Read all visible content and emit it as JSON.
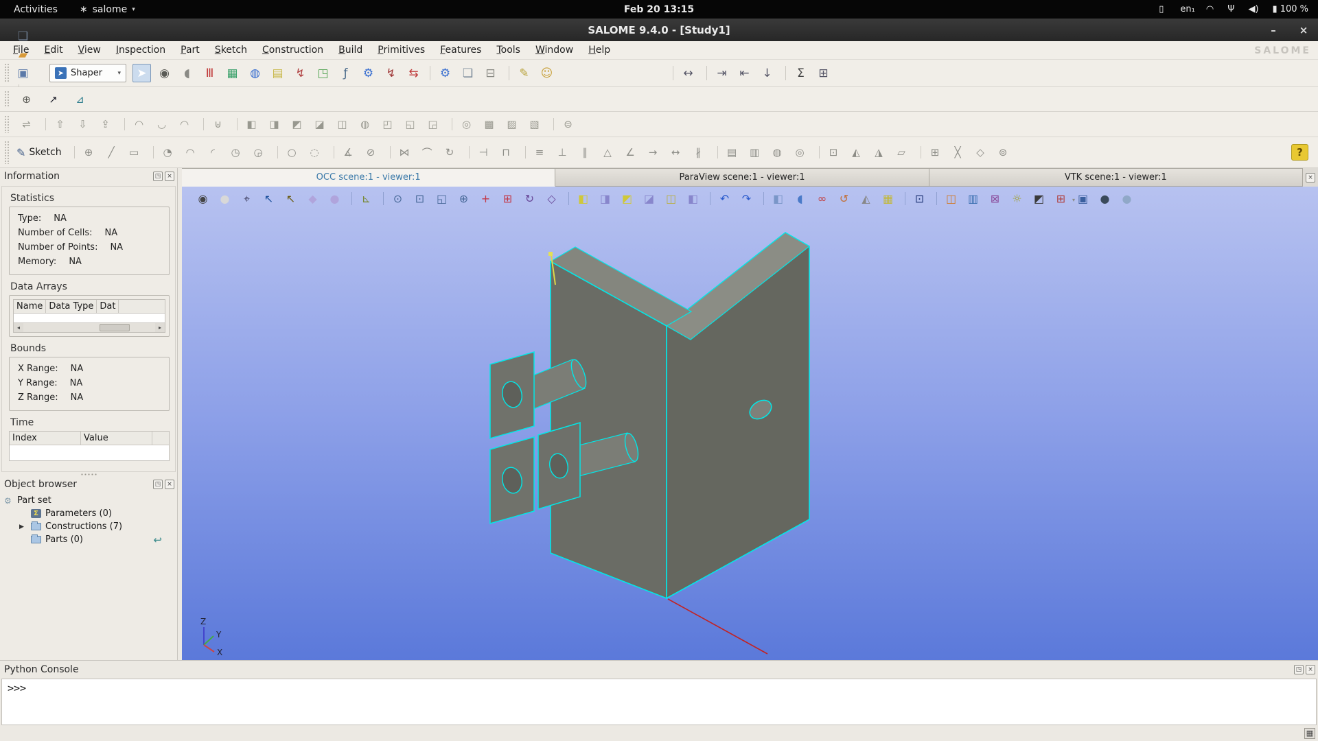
{
  "gnome_bar": {
    "activities": "Activities",
    "app": {
      "icon_glyph": "∗",
      "label": "salome"
    },
    "clock": "Feb 20 13:15",
    "tray": [
      {
        "name": "indicator-icon",
        "glyph": "▯",
        "caret": true
      },
      {
        "name": "keyboard-layout-indicator",
        "label": "en₁",
        "caret": true
      },
      {
        "name": "wifi-icon",
        "glyph": "◠"
      },
      {
        "name": "microphone-icon",
        "glyph": "Ψ"
      },
      {
        "name": "volume-icon",
        "glyph": "◀)"
      },
      {
        "name": "battery-indicator",
        "glyph": "▮",
        "label": "100 %",
        "caret": true
      }
    ]
  },
  "window": {
    "title": "SALOME 9.4.0 - [Study1]",
    "minimize": "–",
    "close": "×"
  },
  "menubar": {
    "items": [
      "File",
      "Edit",
      "View",
      "Inspection",
      "Part",
      "Sketch",
      "Construction",
      "Build",
      "Primitives",
      "Features",
      "Tools",
      "Window",
      "Help"
    ],
    "logo": "SALOME"
  },
  "toolbar_main": {
    "file_icons": [
      {
        "name": "new-document-icon",
        "glyph": "❏",
        "color": "#6f7f93"
      },
      {
        "name": "open-folder-icon",
        "glyph": "▰",
        "color": "#d89a3a"
      },
      {
        "name": "save-icon",
        "glyph": "▣",
        "color": "#5b79a8"
      },
      {
        "name": "undo-icon",
        "glyph": "↶",
        "color": "#8a8a84",
        "caret": true,
        "sep": true
      },
      {
        "name": "redo-icon",
        "glyph": "↷",
        "color": "#8a8a84",
        "caret": true,
        "sep": true
      }
    ],
    "module_combo": {
      "icon": "➤",
      "label": "Shaper"
    },
    "modules": [
      {
        "name": "shaper-module-button",
        "glyph": "➤",
        "color": "#ffffff",
        "press": "blue"
      },
      {
        "name": "search-module-icon",
        "glyph": "◉",
        "color": "#5a5a55"
      },
      {
        "name": "sculpt-module-icon",
        "glyph": "◖",
        "color": "#8a8a85"
      },
      {
        "name": "paravis-module-icon",
        "glyph": "Ⅲ",
        "color": "#c03a3a"
      },
      {
        "name": "mesh-module-icon",
        "glyph": "▦",
        "color": "#3aa06a"
      },
      {
        "name": "geom-module-icon",
        "glyph": "◍",
        "color": "#3a6fd0"
      },
      {
        "name": "notes-module-icon",
        "glyph": "▤",
        "color": "#c8b84a"
      },
      {
        "name": "weld-module-icon",
        "glyph": "↯",
        "color": "#b04040"
      },
      {
        "name": "shape-module-icon",
        "glyph": "◳",
        "color": "#4aa04a"
      },
      {
        "name": "fca-module-icon",
        "glyph": "ƒ",
        "color": "#4a6a8a"
      },
      {
        "name": "gear-module-icon",
        "glyph": "⚙",
        "color": "#3a6fd0"
      },
      {
        "name": "tool-module-icon",
        "glyph": "↯",
        "color": "#a03a3a"
      },
      {
        "name": "split-module-icon",
        "glyph": "⇆",
        "color": "#c03a3a"
      }
    ],
    "actions": [
      {
        "name": "settings-icon",
        "glyph": "⚙",
        "color": "#3a6fd0",
        "sep": true
      },
      {
        "name": "copy-icon",
        "glyph": "❏",
        "color": "#7a8a9a"
      },
      {
        "name": "delete-icon",
        "glyph": "⊟",
        "color": "#8a8a84"
      },
      {
        "name": "script-icon",
        "glyph": "✎",
        "color": "#b8a23a",
        "sep": true
      },
      {
        "name": "user-icon",
        "glyph": "☺",
        "color": "#c8a03a"
      }
    ],
    "study_tools": [
      {
        "name": "fit-width-icon",
        "glyph": "↔",
        "color": "#555566",
        "sep": true
      },
      {
        "name": "export-icon",
        "glyph": "⇥",
        "color": "#555566",
        "sep": true
      },
      {
        "name": "import-icon",
        "glyph": "⇤",
        "color": "#555566"
      },
      {
        "name": "download-icon",
        "glyph": "↓",
        "color": "#555566"
      },
      {
        "name": "sum-icon",
        "glyph": "Σ",
        "color": "#444444",
        "sep": true
      },
      {
        "name": "table-icon",
        "glyph": "⊞",
        "color": "#555566"
      }
    ]
  },
  "toolbar_datum": [
    {
      "name": "datum-point-icon",
      "glyph": "⊕",
      "color": "#555550"
    },
    {
      "name": "datum-axis-icon",
      "glyph": "↗",
      "color": "#22232e"
    },
    {
      "name": "datum-plane-icon",
      "glyph": "⊿",
      "color": "#2a7b8c"
    }
  ],
  "toolbar_features": [
    {
      "name": "feature-part-icon",
      "glyph": "⇌",
      "color": "#98988f"
    },
    {
      "name": "feature-export-icon",
      "glyph": "⇧",
      "color": "#98988f",
      "sep": true
    },
    {
      "name": "feature-import-icon",
      "glyph": "⇩",
      "color": "#98988f"
    },
    {
      "name": "feature-load-icon",
      "glyph": "⇪",
      "color": "#98988f"
    },
    {
      "name": "feature-extrusion-icon",
      "glyph": "◠",
      "color": "#98988f",
      "sep": true
    },
    {
      "name": "feature-extrusion-cut-icon",
      "glyph": "◡",
      "color": "#98988f"
    },
    {
      "name": "feature-extrusion-fuse-icon",
      "glyph": "◠",
      "color": "#98988f"
    },
    {
      "name": "feature-revolution-icon",
      "glyph": "⊎",
      "color": "#98988f",
      "sep": true
    },
    {
      "name": "boolean-cut-icon",
      "glyph": "◧",
      "color": "#98988f",
      "sep": true
    },
    {
      "name": "boolean-fuse-icon",
      "glyph": "◨",
      "color": "#98988f"
    },
    {
      "name": "boolean-common-icon",
      "glyph": "◩",
      "color": "#98988f"
    },
    {
      "name": "boolean-smash-icon",
      "glyph": "◪",
      "color": "#98988f"
    },
    {
      "name": "boolean-fill-icon",
      "glyph": "◫",
      "color": "#98988f"
    },
    {
      "name": "feature-union-icon",
      "glyph": "◍",
      "color": "#98988f"
    },
    {
      "name": "feature-partition-icon",
      "glyph": "◰",
      "color": "#98988f"
    },
    {
      "name": "feature-pipe-icon",
      "glyph": "◱",
      "color": "#98988f"
    },
    {
      "name": "feature-loft-icon",
      "glyph": "◲",
      "color": "#98988f"
    },
    {
      "name": "feature-fillet-icon",
      "glyph": "◎",
      "color": "#98988f",
      "sep": true
    },
    {
      "name": "feature-chamfer-icon",
      "glyph": "▩",
      "color": "#98988f"
    },
    {
      "name": "feature-scale-icon",
      "glyph": "▨",
      "color": "#98988f"
    },
    {
      "name": "feature-measure-icon",
      "glyph": "▧",
      "color": "#98988f"
    },
    {
      "name": "feature-group-icon",
      "glyph": "⊜",
      "color": "#98988f",
      "sep": true
    }
  ],
  "sketch_toolbar": {
    "button_label": "Sketch",
    "tools": [
      {
        "name": "sketch-point-icon",
        "glyph": "⊕",
        "color": "#8d8d87",
        "sep": true
      },
      {
        "name": "sketch-line-icon",
        "glyph": "╱",
        "color": "#8d8d87"
      },
      {
        "name": "sketch-rectangle-icon",
        "glyph": "▭",
        "color": "#8d8d87"
      },
      {
        "name": "sketch-circle-arc-icon",
        "glyph": "◔",
        "color": "#8d8d87",
        "sep": true
      },
      {
        "name": "sketch-arc-icon",
        "glyph": "◠",
        "color": "#8d8d87"
      },
      {
        "name": "sketch-arc-tangent-icon",
        "glyph": "◜",
        "color": "#8d8d87"
      },
      {
        "name": "sketch-arc-center-icon",
        "glyph": "◷",
        "color": "#8d8d87"
      },
      {
        "name": "sketch-arc-three-point-icon",
        "glyph": "◶",
        "color": "#8d8d87"
      },
      {
        "name": "sketch-circle-icon",
        "glyph": "○",
        "color": "#8d8d87",
        "sep": true
      },
      {
        "name": "sketch-ellipse-icon",
        "glyph": "◌",
        "color": "#8d8d87"
      },
      {
        "name": "sketch-fillet-icon",
        "glyph": "∡",
        "color": "#8d8d87",
        "sep": true
      },
      {
        "name": "sketch-trim-icon",
        "glyph": "⊘",
        "color": "#8d8d87"
      },
      {
        "name": "sketch-mirror-icon",
        "glyph": "⋈",
        "color": "#8d8d87",
        "sep": true
      },
      {
        "name": "sketch-offset-icon",
        "glyph": "⌒",
        "color": "#8d8d87"
      },
      {
        "name": "sketch-rotate-icon",
        "glyph": "↻",
        "color": "#8d8d87"
      },
      {
        "name": "constraint-distance-icon",
        "glyph": "⊣",
        "color": "#8d8d87",
        "sep": true
      },
      {
        "name": "constraint-length-icon",
        "glyph": "⊓",
        "color": "#8d8d87"
      },
      {
        "name": "constraint-equal-icon",
        "glyph": "≡",
        "color": "#8d8d87",
        "sep": true
      },
      {
        "name": "constraint-perpendicular-icon",
        "glyph": "⊥",
        "color": "#8d8d87"
      },
      {
        "name": "constraint-parallel-icon",
        "glyph": "∥",
        "color": "#8d8d87"
      },
      {
        "name": "constraint-horizontal-icon",
        "glyph": "△",
        "color": "#8d8d87"
      },
      {
        "name": "constraint-angle-icon",
        "glyph": "∠",
        "color": "#8d8d87"
      },
      {
        "name": "constraint-tangent-icon",
        "glyph": "→",
        "color": "#8d8d87"
      },
      {
        "name": "constraint-middle-icon",
        "glyph": "↔",
        "color": "#8d8d87"
      },
      {
        "name": "constraint-collinear-icon",
        "glyph": "∦",
        "color": "#8d8d87"
      },
      {
        "name": "sketch-projection-icon",
        "glyph": "▤",
        "color": "#8d8d87",
        "sep": true
      },
      {
        "name": "sketch-intersection-icon",
        "glyph": "▥",
        "color": "#8d8d87"
      },
      {
        "name": "sketch-split-icon",
        "glyph": "◍",
        "color": "#8d8d87"
      },
      {
        "name": "sketch-substitution-icon",
        "glyph": "◎",
        "color": "#8d8d87"
      },
      {
        "name": "sketch-copy-icon",
        "glyph": "⊡",
        "color": "#8d8d87",
        "sep": true
      },
      {
        "name": "sketch-multi-rotate-icon",
        "glyph": "◭",
        "color": "#8d8d87"
      },
      {
        "name": "sketch-multi-translate-icon",
        "glyph": "◮",
        "color": "#8d8d87"
      },
      {
        "name": "sketch-pattern-icon",
        "glyph": "▱",
        "color": "#8d8d87"
      },
      {
        "name": "sketch-options-icon",
        "glyph": "⊞",
        "color": "#8d8d87",
        "sep": true
      },
      {
        "name": "sketch-cross-icon",
        "glyph": "╳",
        "color": "#8d8d87"
      },
      {
        "name": "sketch-rhombus-icon",
        "glyph": "◇",
        "color": "#8d8d87"
      },
      {
        "name": "sketch-target-icon",
        "glyph": "⊚",
        "color": "#8d8d87"
      }
    ],
    "help_glyph": "?"
  },
  "tabs": [
    {
      "name": "tab-occ-viewer",
      "label": "OCC scene:1 - viewer:1",
      "active": true
    },
    {
      "name": "tab-paraview-viewer",
      "label": "ParaView scene:1 - viewer:1",
      "active": false
    },
    {
      "name": "tab-vtk-viewer",
      "label": "VTK scene:1 - viewer:1",
      "active": false
    }
  ],
  "tab_close_glyph": "×",
  "info_panel": {
    "title": "Information",
    "float_glyph": "◳",
    "close_glyph": "×",
    "statistics": {
      "label": "Statistics",
      "rows": [
        {
          "label": "Type:",
          "value": "NA"
        },
        {
          "label": "Number of Cells:",
          "value": "NA"
        },
        {
          "label": "Number of Points:",
          "value": "NA"
        },
        {
          "label": "Memory:",
          "value": "NA"
        }
      ]
    },
    "data_arrays": {
      "label": "Data Arrays",
      "headers": [
        "Name",
        "Data Type",
        "Dat"
      ]
    },
    "bounds": {
      "label": "Bounds",
      "rows": [
        {
          "label": "X Range:",
          "value": "NA"
        },
        {
          "label": "Y Range:",
          "value": "NA"
        },
        {
          "label": "Z Range:",
          "value": "NA"
        }
      ]
    },
    "time": {
      "label": "Time",
      "headers": [
        "Index",
        "Value"
      ]
    }
  },
  "object_browser": {
    "title": "Object browser",
    "float_glyph": "◳",
    "close_glyph": "×",
    "root": {
      "label": "Part set",
      "icon_glyph": "⚙",
      "icon_color": "#7f9aaa"
    },
    "items": [
      {
        "name": "tree-item-parameters",
        "label": "Parameters (0)",
        "icon": "sigma"
      },
      {
        "name": "tree-item-constructions",
        "label": "Constructions (7)",
        "icon": "folder",
        "expandable": true
      },
      {
        "name": "tree-item-parts",
        "label": "Parts (0)",
        "icon": "folder",
        "action_glyph": "↩"
      }
    ]
  },
  "viewport": {
    "toolbar": [
      {
        "name": "dump-view-icon",
        "glyph": "◉",
        "color": "#444444"
      },
      {
        "name": "mouse-style-icon",
        "glyph": "●",
        "color": "#d8d8d8"
      },
      {
        "name": "interaction-style-icon",
        "glyph": "⌖",
        "color": "#444466"
      },
      {
        "name": "select-arrow-icon",
        "glyph": "↖",
        "color": "#1a4f9c",
        "press": "blue"
      },
      {
        "name": "select-rect-icon",
        "glyph": "↖",
        "color": "#6a5a10",
        "press": "yellow"
      },
      {
        "name": "polygon-selection-icon",
        "glyph": "◆",
        "color": "#b0a4dc"
      },
      {
        "name": "circle-selection-icon",
        "glyph": "●",
        "color": "#b0a4dc"
      },
      {
        "name": "trihedron-icon",
        "glyph": "⊾",
        "color": "#7a8a3a",
        "sep": true
      },
      {
        "name": "zoom-icon",
        "glyph": "⊙",
        "color": "#4a6a9a",
        "sep": true
      },
      {
        "name": "zoom-window-icon",
        "glyph": "⊡",
        "color": "#4a6a9a"
      },
      {
        "name": "zoom-region-icon",
        "glyph": "◱",
        "color": "#4a6a9a"
      },
      {
        "name": "zoom-plus-icon",
        "glyph": "⊕",
        "color": "#4a6a9a"
      },
      {
        "name": "pan-icon",
        "glyph": "+",
        "color": "#c23a4a"
      },
      {
        "name": "global-pan-icon",
        "glyph": "⊞",
        "color": "#c23a4a"
      },
      {
        "name": "rotate-icon",
        "glyph": "↻",
        "color": "#6a4a9a"
      },
      {
        "name": "rotation-point-icon",
        "glyph": "◇",
        "color": "#6a4a9a"
      },
      {
        "name": "front-view-icon",
        "glyph": "◧",
        "color": "#cfc83a",
        "sep": true
      },
      {
        "name": "back-view-icon",
        "glyph": "◨",
        "color": "#8886cc"
      },
      {
        "name": "top-view-icon",
        "glyph": "◩",
        "color": "#cfc83a"
      },
      {
        "name": "bottom-view-icon",
        "glyph": "◪",
        "color": "#8886cc"
      },
      {
        "name": "left-view-icon",
        "glyph": "◫",
        "color": "#b8b048"
      },
      {
        "name": "right-view-icon",
        "glyph": "◧",
        "color": "#8886cc"
      },
      {
        "name": "undo-view-icon",
        "glyph": "↶",
        "color": "#2a5acc",
        "sep": true
      },
      {
        "name": "redo-view-icon",
        "glyph": "↷",
        "color": "#2a5acc"
      },
      {
        "name": "isometric-view-icon",
        "glyph": "◧",
        "color": "#7a96c8",
        "press": "gray",
        "sep": true
      },
      {
        "name": "clipping-icon",
        "glyph": "◖",
        "color": "#4a7ac8"
      },
      {
        "name": "stereo-icon",
        "glyph": "∞",
        "color": "#c23a3a"
      },
      {
        "name": "rotate-animation-icon",
        "glyph": "↺",
        "color": "#c2703a"
      },
      {
        "name": "projector-icon",
        "glyph": "◭",
        "color": "#888888"
      },
      {
        "name": "scene-graph-icon",
        "glyph": "▦",
        "color": "#c2b83a"
      },
      {
        "name": "background-settings-icon",
        "glyph": "⊡",
        "color": "#22387a",
        "sep": true
      },
      {
        "name": "sync-views-icon",
        "glyph": "◫",
        "color": "#d07a2a",
        "sep": true
      },
      {
        "name": "ruler-icon",
        "glyph": "▥",
        "color": "#3a6fb0"
      },
      {
        "name": "axes-box-icon",
        "glyph": "⊠",
        "color": "#8a4a9a"
      },
      {
        "name": "ambient-light-icon",
        "glyph": "☼",
        "color": "#a0a030"
      },
      {
        "name": "shadow-icon",
        "glyph": "◩",
        "color": "#3a3a3a"
      },
      {
        "name": "multi-view-icon",
        "glyph": "⊞",
        "color": "#b04040",
        "caret": true
      },
      {
        "name": "window-layout-icon",
        "glyph": "▣",
        "color": "#3a5f9e"
      },
      {
        "name": "shading-off-icon",
        "glyph": "●",
        "color": "#3a4a5a"
      },
      {
        "name": "shading-on-icon",
        "glyph": "●",
        "color": "#90a8c8"
      }
    ],
    "axis": {
      "z": "Z",
      "y": "Y",
      "x": "X"
    },
    "colors": {
      "edge": "#00e8e8",
      "face_dark": "#65675f",
      "face_mid": "#6a6c65",
      "face_light": "#8b8d85",
      "marker_yellow": "#ddd94a",
      "axis_line_red": "#c22222"
    }
  },
  "python_console": {
    "title": "Python Console",
    "prompt": ">>>",
    "float_glyph": "◳",
    "close_glyph": "×"
  },
  "statusbar": {
    "icon_glyph": "▦"
  }
}
